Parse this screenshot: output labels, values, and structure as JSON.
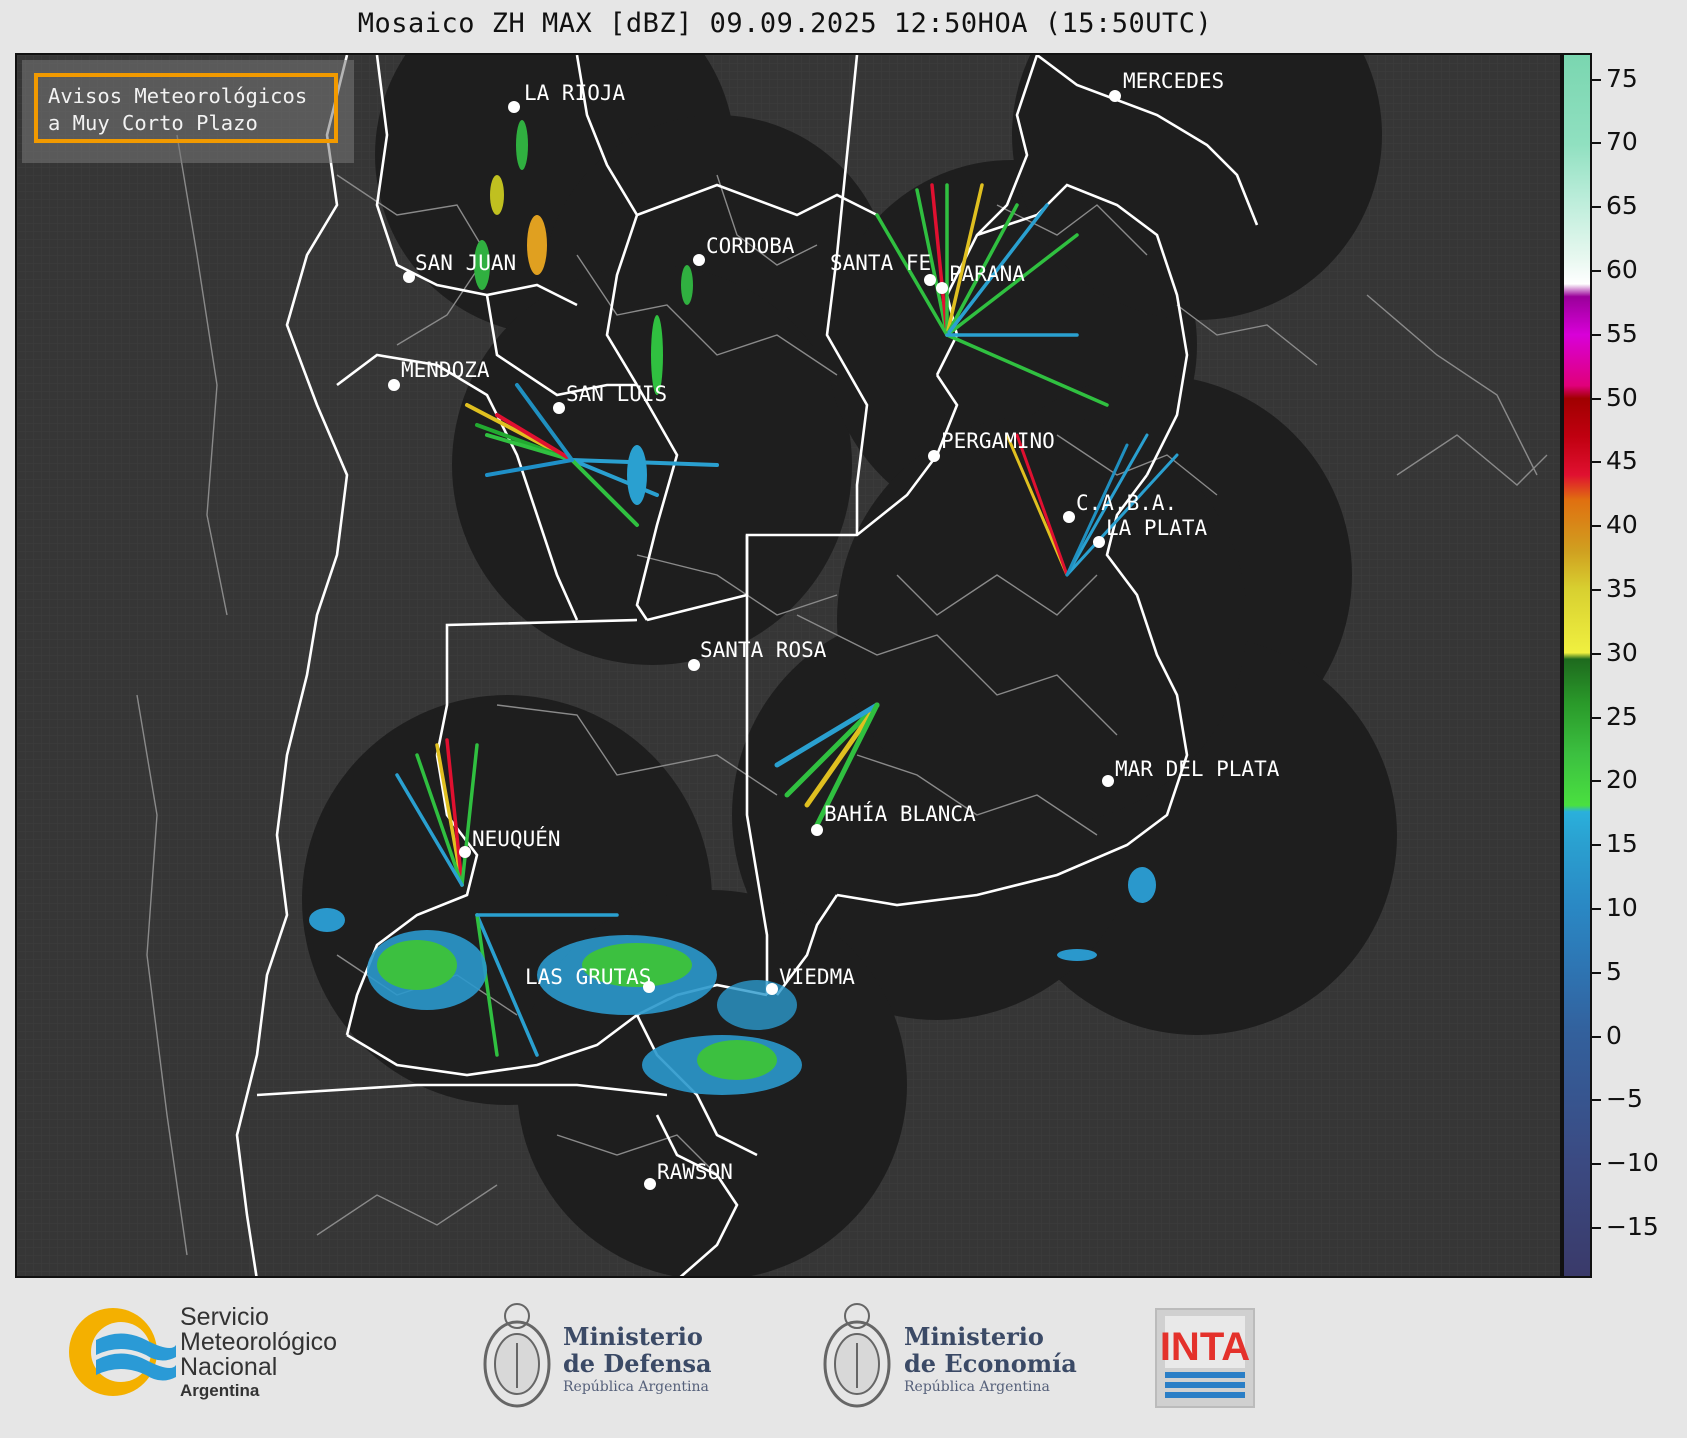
{
  "title": "Mosaico ZH MAX [dBZ] 09.09.2025 12:50HOA (15:50UTC)",
  "warning_box": {
    "line1": "Avisos Meteorológicos",
    "line2": "a Muy Corto Plazo"
  },
  "cities": [
    {
      "name": "LA RIOJA"
    },
    {
      "name": "MERCEDES"
    },
    {
      "name": "CORDOBA"
    },
    {
      "name": "SAN JUAN"
    },
    {
      "name": "SANTA FE"
    },
    {
      "name": "PARANA"
    },
    {
      "name": "MENDOZA"
    },
    {
      "name": "SAN LUIS"
    },
    {
      "name": "PERGAMINO"
    },
    {
      "name": "C.A.B.A."
    },
    {
      "name": "LA PLATA"
    },
    {
      "name": "SANTA ROSA"
    },
    {
      "name": "MAR DEL PLATA"
    },
    {
      "name": "BAHÍA BLANCA"
    },
    {
      "name": "NEUQUÉN"
    },
    {
      "name": "LAS GRUTAS"
    },
    {
      "name": "VIEDMA"
    },
    {
      "name": "RAWSON"
    }
  ],
  "colorbar": {
    "unit": "dBZ",
    "min": -19,
    "max": 77,
    "ticks": [
      "75",
      "70",
      "65",
      "60",
      "55",
      "50",
      "45",
      "40",
      "35",
      "30",
      "25",
      "20",
      "15",
      "10",
      "5",
      "0",
      "−5",
      "−10",
      "−15"
    ],
    "tick_values": [
      75,
      70,
      65,
      60,
      55,
      50,
      45,
      40,
      35,
      30,
      25,
      20,
      15,
      10,
      5,
      0,
      -5,
      -10,
      -15
    ]
  },
  "colors": {
    "map_background": "#363636",
    "radar_coverage": "#1e1e1e",
    "province_border": "#ffffff",
    "department_border": "#8a8a8a",
    "warning_border": "#f29a00"
  },
  "footer": {
    "smn": {
      "line1": "Servicio",
      "line2": "Meteorológico",
      "line3": "Nacional",
      "line4": "Argentina"
    },
    "defensa": {
      "line1": "Ministerio",
      "line2": "de Defensa",
      "line3": "República Argentina"
    },
    "economia": {
      "line1": "Ministerio",
      "line2": "de Economía",
      "line3": "República Argentina"
    },
    "inta": {
      "label": "INTA"
    }
  }
}
